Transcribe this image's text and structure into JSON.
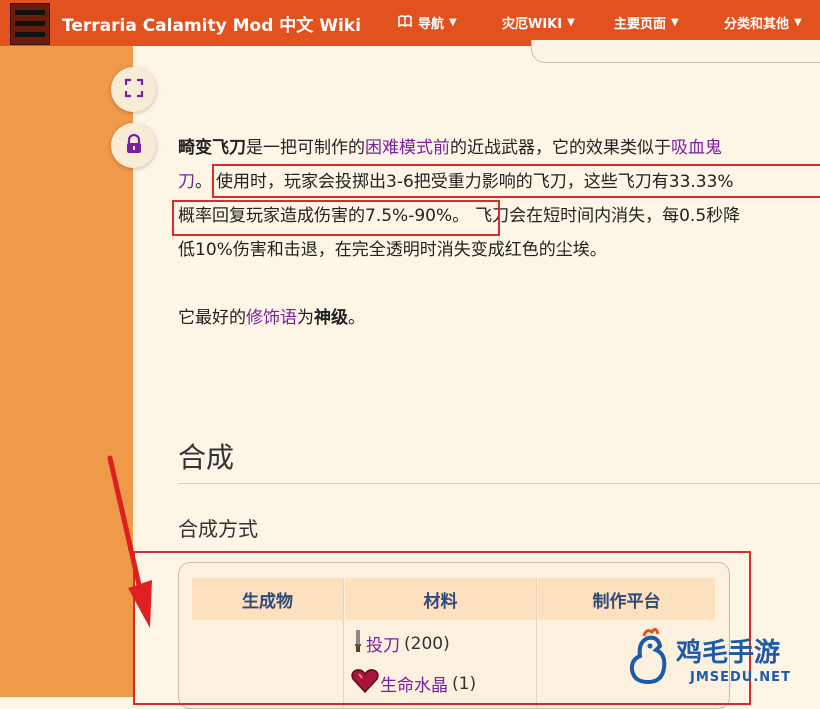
{
  "header": {
    "site_title": "Terraria Calamity Mod 中文 Wiki",
    "nav": [
      {
        "label": "导航",
        "icon": "book-icon"
      },
      {
        "label": "灾厄WIKI"
      },
      {
        "label": "主要页面"
      },
      {
        "label": "分类和其他"
      }
    ]
  },
  "side_buttons": {
    "fullscreen_icon": "fullscreen-icon",
    "lock_icon": "lock-icon"
  },
  "article": {
    "line1": {
      "bold": "畸变飞刀",
      "t1": "是一把可制作的",
      "link1": "困难模式前",
      "t2": "的近战武器，它的效果类似于",
      "link2": "吸血鬼"
    },
    "line2": {
      "link": "刀",
      "t1": "。",
      "t2": "使用时，玩家会投掷出3-6把受重力影响的飞刀，这些飞刀有33.33%"
    },
    "line3": {
      "t1": "概率回复玩家造成伤害的7.5%-90%。",
      "t2": "飞刀会在短时间内消失，每0.5秒降"
    },
    "line4": {
      "t1": "低10%伤害和击退，在完全透明时消失变成红色的尘埃。"
    },
    "line5": {
      "t1": "它最好的",
      "link": "修饰语",
      "t2": "为",
      "bold": "神级",
      "t3": "。"
    },
    "section_title": "合成",
    "sub_title": "合成方式"
  },
  "craft_table": {
    "headers": [
      "生成物",
      "材料",
      "制作平台"
    ],
    "materials": [
      {
        "name": "投刀",
        "qty": "(200)"
      },
      {
        "name": "生命水晶",
        "qty": "(1)"
      }
    ]
  },
  "watermark": {
    "title": "鸡毛手游",
    "url": "JMSEDU.NET"
  },
  "colors": {
    "header_bg": "#e2521f",
    "sidebar_bg": "#ef9a49",
    "content_bg": "#fdf5e6",
    "link": "#7b1fa2",
    "highlight": "#d92b2b"
  }
}
